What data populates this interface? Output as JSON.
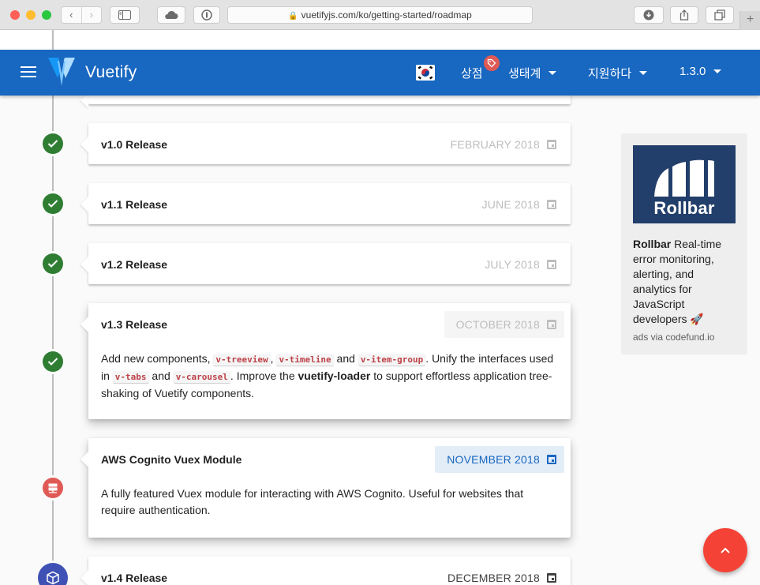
{
  "browser": {
    "url": "vuetifyjs.com/ko/getting-started/roadmap",
    "new_tab": "+"
  },
  "appbar": {
    "brand": "Vuetify",
    "store": "상점",
    "ecosystem": "생태계",
    "support": "지원하다",
    "version": "1.3.0"
  },
  "timeline": [
    {
      "title": "v1.0 Release",
      "date": "FEBRUARY 2018"
    },
    {
      "title": "v1.1 Release",
      "date": "JUNE 2018"
    },
    {
      "title": "v1.2 Release",
      "date": "JULY 2018"
    },
    {
      "title": "v1.3 Release",
      "date": "OCTOBER 2018",
      "body": {
        "t1": "Add new components, ",
        "c1": "v-treeview",
        "t2": ", ",
        "c2": "v-timeline",
        "t3": " and ",
        "c3": "v-item-group",
        "t4": ". Unify the interfaces used in ",
        "c4": "v-tabs",
        "t5": " and ",
        "c5": "v-carousel",
        "t6": ". Improve the ",
        "b1": "vuetify-loader",
        "t7": " to support effortless application tree-shaking of Vuetify components."
      }
    },
    {
      "title": "AWS Cognito Vuex Module",
      "date": "NOVEMBER 2018",
      "body": "A fully featured Vuex module for interacting with AWS Cognito. Useful for websites that require authentication."
    },
    {
      "title": "v1.4 Release",
      "date": "DECEMBER 2018"
    }
  ],
  "ad": {
    "logo_text": "Rollbar",
    "name": "Rollbar",
    "text": " Real-time error monitoring, alerting, and analytics for JavaScript developers 🚀",
    "via": "ads via codefund.io"
  },
  "colors": {
    "primary": "#1867c0",
    "success": "#2e7d32",
    "error": "#e05a55",
    "indigo": "#3f51b5",
    "fab": "#f44336"
  },
  "icons": {
    "back": "chevron-left-icon",
    "forward": "chevron-right-icon",
    "sidebar": "sidebar-icon",
    "cloud": "cloud-icon",
    "password": "password-manager-icon",
    "download": "download-icon",
    "share": "share-icon",
    "tabs": "tabs-icon",
    "menu": "menu-icon",
    "flag": "korea-flag-icon",
    "tag": "tag-icon",
    "check": "check-icon",
    "server": "server-icon",
    "cube": "cube-icon",
    "calendar": "calendar-icon",
    "up": "chevron-up-icon"
  }
}
